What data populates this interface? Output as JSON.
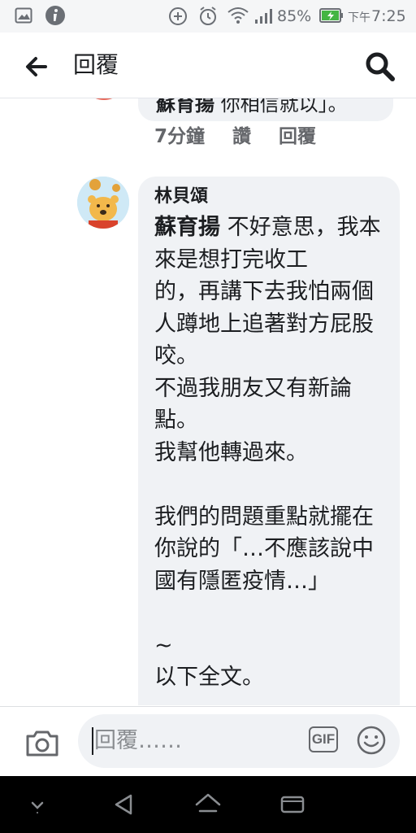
{
  "status_bar": {
    "battery_percent": "85%",
    "time": "7:25",
    "time_period": "下午",
    "icons": [
      "image-icon",
      "info-icon",
      "data-saver-icon",
      "alarm-icon",
      "wifi-icon",
      "signal-icon",
      "battery-charging-icon"
    ]
  },
  "header": {
    "title": "回覆",
    "back_icon": "arrow-left-icon",
    "search_icon": "search-icon"
  },
  "previous_comment": {
    "author": "蘇育揚",
    "text_fragment": "你相信就以」。",
    "time": "7分鐘",
    "like_label": "讚",
    "reply_label": "回覆"
  },
  "comment": {
    "author": "林貝頌",
    "mention": "蘇育揚",
    "body": " 不好意思，我本來是想打完收工\n的，再講下去我怕兩個人蹲地上追著對方屁股咬。\n不過我朋友又有新論點。\n我幫他轉過來。\n\n我們的問題重點就擺在你說的「…不應該說中國有隱匿疫情…」\n\n~\n以下全文。\n\n「不用講那麼多五四"
  },
  "composer": {
    "placeholder": "回覆……",
    "gif_label": "GIF",
    "camera_icon": "camera-icon",
    "emoji_icon": "emoji-icon"
  },
  "navbar": {
    "icons": [
      "chevron-down-icon",
      "back-triangle-icon",
      "home-icon",
      "recents-icon"
    ]
  },
  "colors": {
    "bubble_bg": "#f0f2f5",
    "secondary_text": "#65676b",
    "status_bar_bg": "#f5f6f7",
    "nav_bg": "#000000"
  }
}
